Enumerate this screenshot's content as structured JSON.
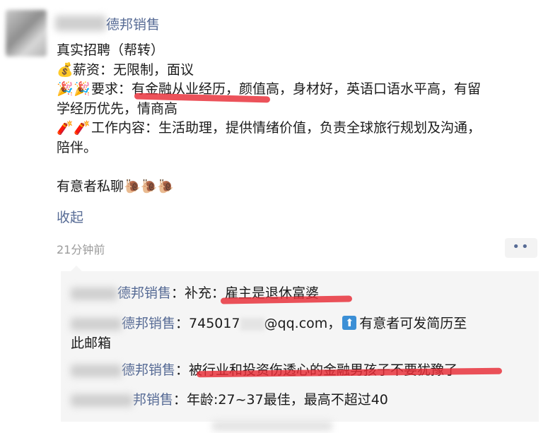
{
  "post": {
    "author": "德邦销售",
    "line1": "真实招聘（帮转）",
    "salary": {
      "icon": "💰",
      "text": "薪资：无限制，面议"
    },
    "requirements": {
      "icon": "🎉🎉",
      "text": "要求：有金融从业经历，颜值高，身材好，英语口语水平高，有留",
      "text2": "学经历优先，情商高"
    },
    "work": {
      "icon": "🧨🧨",
      "text": "工作内容：生活助理，提供情绪价值，负责全球旅行规划及沟通，",
      "text2": "陪伴。"
    },
    "contact": {
      "text": "有意者私聊",
      "icons": "🐌🐌🐌"
    },
    "collapse_label": "收起",
    "time": "21分钟前",
    "more_label": "••"
  },
  "comments": [
    {
      "name": "德邦销售",
      "text": "：补充：雇主是退休富婆"
    },
    {
      "name": "德邦销售",
      "text_before": "：745017",
      "text_after": "@qq.com，",
      "share_icon": "⬆",
      "text_tail": "有意者可发简历至",
      "text2": "此邮箱"
    },
    {
      "name": "德邦销售",
      "text": "：被行业和投资伤透心的金融男孩子不要犹豫了"
    },
    {
      "name": "邦销售",
      "text": "：年龄:27~37最佳，最高不超过40"
    }
  ],
  "colors": {
    "name": "#576b95",
    "annotation": "#e82c36",
    "comment_bg": "#f5f5f5"
  }
}
